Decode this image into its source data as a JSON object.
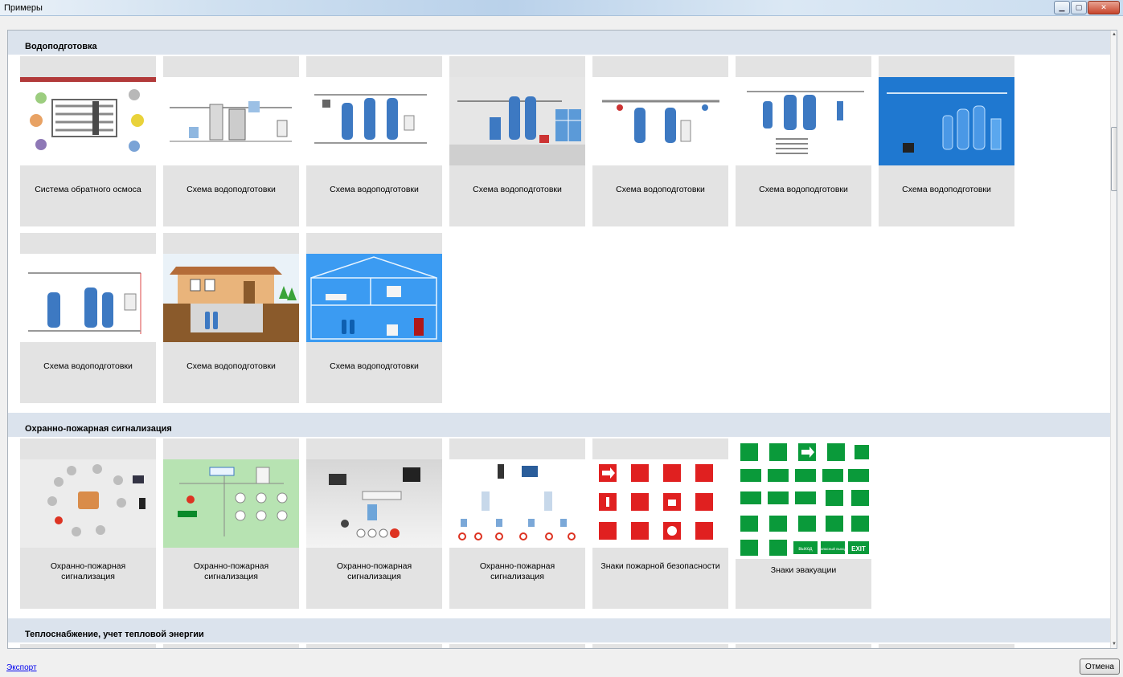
{
  "window": {
    "title": "Примеры",
    "minimize_icon": "minimize-icon",
    "maximize_icon": "maximize-icon",
    "close_icon": "close-icon"
  },
  "sections": [
    {
      "title": "Водоподготовка",
      "cards": [
        {
          "label": "Система обратного осмоса",
          "thumb": "reverse-osmosis"
        },
        {
          "label": "Схема водоподготовки",
          "thumb": "water-scheme-1"
        },
        {
          "label": "Схема водоподготовки",
          "thumb": "water-scheme-2"
        },
        {
          "label": "Схема водоподготовки",
          "thumb": "water-scheme-3"
        },
        {
          "label": "Схема водоподготовки",
          "thumb": "water-scheme-4"
        },
        {
          "label": "Схема водоподготовки",
          "thumb": "water-scheme-5"
        },
        {
          "label": "Схема водоподготовки",
          "thumb": "water-scheme-blue"
        },
        {
          "label": "Схема водоподготовки",
          "thumb": "water-scheme-6"
        },
        {
          "label": "Схема водоподготовки",
          "thumb": "house"
        },
        {
          "label": "Схема водоподготовки",
          "thumb": "house-blue"
        }
      ]
    },
    {
      "title": "Охранно-пожарная сигнализация",
      "cards": [
        {
          "label": "Охранно-пожарная сигнализация",
          "thumb": "alarm-1"
        },
        {
          "label": "Охранно-пожарная сигнализация",
          "thumb": "alarm-green"
        },
        {
          "label": "Охранно-пожарная сигнализация",
          "thumb": "alarm-3"
        },
        {
          "label": "Охранно-пожарная сигнализация",
          "thumb": "alarm-4"
        },
        {
          "label": "Знаки пожарной безопасности",
          "thumb": "fire-signs"
        },
        {
          "label": "Знаки эвакуации",
          "thumb": "evac-signs"
        }
      ]
    },
    {
      "title": "Теплоснабжение, учет тепловой энергии"
    }
  ],
  "footer": {
    "export_label": "Экспорт",
    "cancel_label": "Отмена"
  },
  "evac_sign_text": {
    "exit_ru": "выход",
    "emergency_exit_ru": "запасный выход",
    "exit_en": "EXIT"
  }
}
